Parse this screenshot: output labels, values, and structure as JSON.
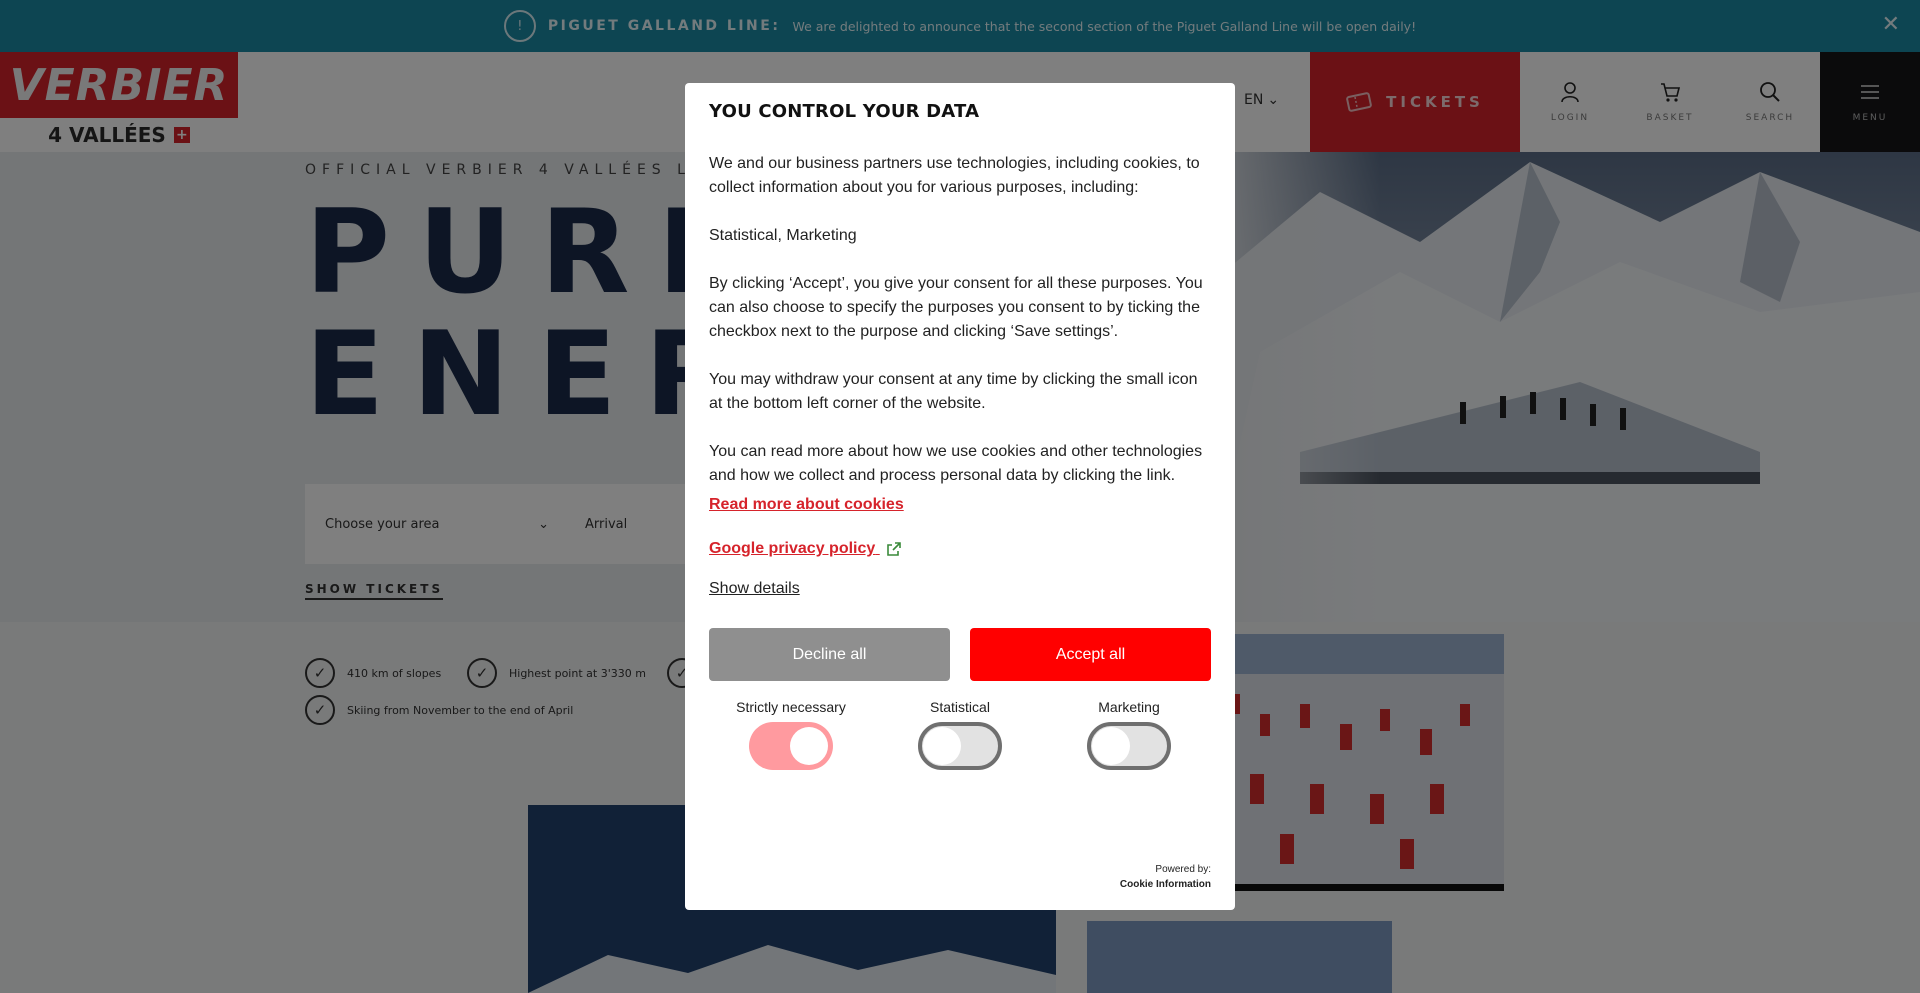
{
  "announcement": {
    "icon": "warning-icon",
    "title": "PIGUET GALLAND LINE:",
    "text": "We are delighted to announce that the second section of the Piguet Galland Line will be open daily!",
    "close_icon": "close-icon"
  },
  "header": {
    "logo_top": "VERBIER",
    "logo_bottom": "4 VALLÉES",
    "swiss_cross": "+",
    "language": "EN",
    "tickets_label": "TICKETS",
    "login_label": "LOGIN",
    "basket_label": "BASKET",
    "search_label": "SEARCH",
    "menu_label": "MENU"
  },
  "hero": {
    "subtitle": "OFFICIAL VERBIER 4 VALLÉES LIFTS",
    "title_line1": "PURE",
    "title_line2": "ENERG",
    "area_placeholder": "Choose your area",
    "arrival_placeholder": "Arrival",
    "show_tickets": "SHOW TICKETS"
  },
  "features": [
    "410 km of slopes",
    "Highest point at 3'330 m",
    "Skiing from November to the end of April"
  ],
  "cookie_modal": {
    "title": "YOU CONTROL YOUR DATA",
    "intro": "We and our business partners use technologies, including cookies, to collect information about you for various purposes, including:",
    "purposes": "Statistical, Marketing",
    "consent_text": "By clicking ‘Accept’, you give your consent for all these purposes. You can also choose to specify the purposes you consent to by ticking the checkbox next to the purpose and clicking ‘Save settings’.",
    "withdraw_text": "You may withdraw your consent at any time by clicking the small icon at the bottom left corner of the website.",
    "read_more_text": "You can read more about how we use cookies and other technologies and how we collect and process personal data by clicking the link.",
    "link_cookies": "Read more about cookies",
    "link_google": "Google privacy policy",
    "show_details": "Show details",
    "decline_label": "Decline all",
    "accept_label": "Accept all",
    "toggles": [
      {
        "label": "Strictly necessary",
        "on": true
      },
      {
        "label": "Statistical",
        "on": false
      },
      {
        "label": "Marketing",
        "on": false
      }
    ],
    "powered_by": "Powered by:",
    "powered_brand": "Cookie Information",
    "accent_color": "#ff0000",
    "link_color": "#d6232b"
  }
}
